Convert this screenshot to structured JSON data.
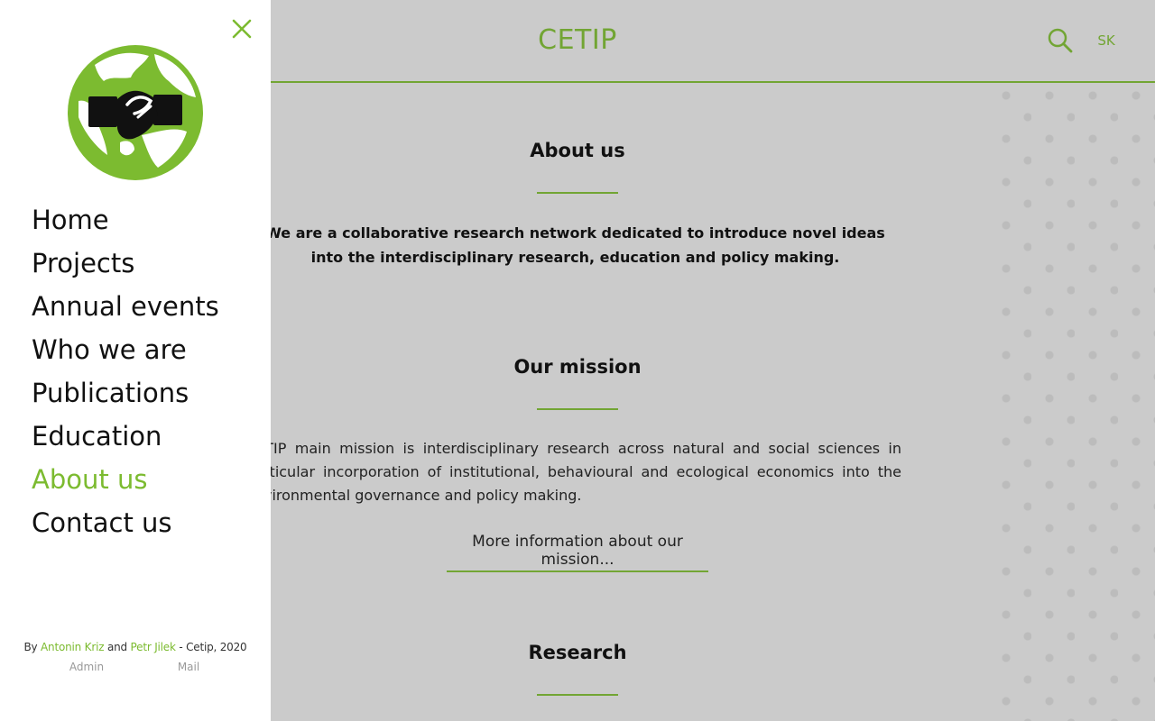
{
  "header": {
    "site_title": "CETIP",
    "language": "SK"
  },
  "drawer": {
    "nav": [
      {
        "label": "Home"
      },
      {
        "label": "Projects"
      },
      {
        "label": "Annual events"
      },
      {
        "label": "Who we are"
      },
      {
        "label": "Publications"
      },
      {
        "label": "Education"
      },
      {
        "label": "About us",
        "active": true
      },
      {
        "label": "Contact us"
      }
    ],
    "footer": {
      "by": "By",
      "author1": "Antonin Kriz",
      "and": "and",
      "author2": "Petr Jilek",
      "suffix": "- Cetip, 2020",
      "admin": "Admin",
      "mail": "Mail"
    }
  },
  "main": {
    "about": {
      "title": "About us",
      "text": "We are a collaborative research network dedicated to introduce novel ideas into the interdisciplinary research, education and policy making."
    },
    "mission": {
      "title": "Our mission",
      "text": "CETIP main mission is interdisciplinary research across natural and social sciences in particular incorporation of institutional, behavioural and ecological economics into the environmental governance and policy making.",
      "link": "More information about our mission..."
    },
    "research": {
      "title": "Research"
    }
  },
  "colors": {
    "accent": "#72a534",
    "accent_light": "#7cbb30",
    "background": "#cbcbcb",
    "drawer": "#ffffff"
  },
  "icons": [
    "close-icon",
    "globe-handshake-logo",
    "search-icon"
  ]
}
